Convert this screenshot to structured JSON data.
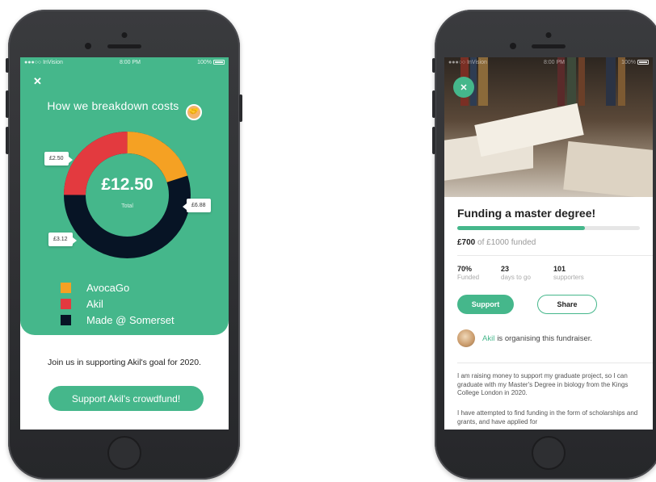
{
  "colors": {
    "brand_green": "#45b78b",
    "avocago": "#f5a123",
    "akil": "#e33a3f",
    "somerset": "#071425"
  },
  "left_screen": {
    "status": {
      "carrier": "●●●○○ InVision",
      "wifi_icon": "wifi-icon",
      "time": "8:00 PM",
      "battery": "100%"
    },
    "close_icon": "close-icon",
    "title": "How we breakdown costs",
    "title_icon": "handshake-icon",
    "donut": {
      "total": "£12.50",
      "total_label": "Total"
    },
    "callouts": {
      "avocago": "£2.50",
      "somerset": "£6.88",
      "akil": "£3.12"
    },
    "legend": [
      {
        "label": "AvocaGo",
        "color": "#f5a123"
      },
      {
        "label": "Akil",
        "color": "#e33a3f"
      },
      {
        "label": "Made @ Somerset",
        "color": "#071425"
      }
    ],
    "join_text": "Join us in supporting Akil's goal for 2020.",
    "crowdfund_button": "Support Akil's crowdfund!"
  },
  "right_screen": {
    "status": {
      "carrier": "●●●○○ InVision",
      "wifi_icon": "wifi-icon",
      "time": "8:00 PM",
      "battery": "100%"
    },
    "close_icon": "close-icon",
    "hero_image": "open-books-photo",
    "title": "Funding a master degree!",
    "progress_fraction": 0.7,
    "funded_amount": "£700",
    "funded_rest": "of £1000 funded",
    "stats": [
      {
        "value": "70%",
        "label": "Funded"
      },
      {
        "value": "23",
        "label": "days to go"
      },
      {
        "value": "101",
        "label": "supporters"
      }
    ],
    "support_button": "Support",
    "share_button": "Share",
    "organiser_name": "Akil",
    "organiser_text": "is organising this fundraiser.",
    "paragraph1": "I am raising money to support my graduate project, so I can graduate with my Master's Degree in biology from the Kings College London in 2020.",
    "paragraph2": "I have attempted to find funding in the form of scholarships and grants, and have applied for"
  }
}
